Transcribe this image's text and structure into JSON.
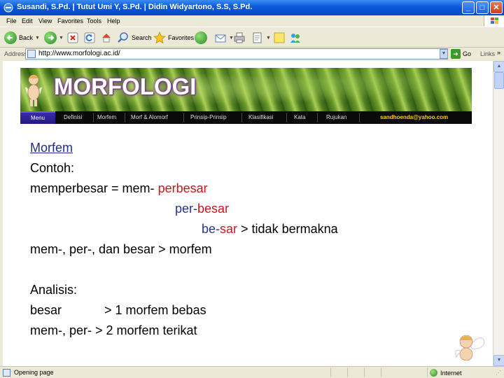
{
  "window": {
    "title": "Susandi, S.Pd. | Tutut Umi Y, S.Pd. | Didin Widyartono, S.S, S.Pd.",
    "controls": {
      "minimize": "_",
      "maximize": "□",
      "close": "✕"
    }
  },
  "menu": [
    "File",
    "Edit",
    "View",
    "Favorites",
    "Tools",
    "Help"
  ],
  "toolbar": {
    "back": "Back",
    "search": "Search",
    "favorites": "Favorites"
  },
  "address": {
    "label": "Address",
    "url": "http://www.morfologi.ac.id/",
    "go": "Go",
    "links": "Links",
    "links_chevron": "»"
  },
  "site": {
    "title": "MORFOLOGI",
    "nav": {
      "items": [
        "Menu",
        "Definisi",
        "Morfem",
        "Morf & Alomorf",
        "Prinsip-Prinsip",
        "Klasifikasi",
        "Kata",
        "Rujukan"
      ],
      "email": "sandhoenda@yahoo.com"
    }
  },
  "content": {
    "heading": "Morfem",
    "example_label": "Contoh:",
    "line1": {
      "left": "memperbesar = mem- ",
      "right": "perbesar"
    },
    "line2": {
      "prefix": "per-",
      "root": "besar"
    },
    "line3": {
      "prefix": "be-",
      "root": "sar",
      "rest": " > tidak bermakna"
    },
    "line4": "mem-, per-, dan besar > morfem",
    "analysis_label": "Analisis:",
    "analysis1": {
      "term": "besar",
      "result": "> 1 morfem bebas"
    },
    "analysis2": "mem-, per- > 2 morfem terikat"
  },
  "status": {
    "text": "Opening page",
    "zone": "Internet",
    "grip": "⋰"
  },
  "colors": {
    "titlebar": "#0a58d8",
    "chrome": "#ece9d8",
    "link_blue": "#27348b",
    "accent_red": "#c8161d",
    "nav_active": "#241a80",
    "email_yellow": "#ffd000"
  }
}
